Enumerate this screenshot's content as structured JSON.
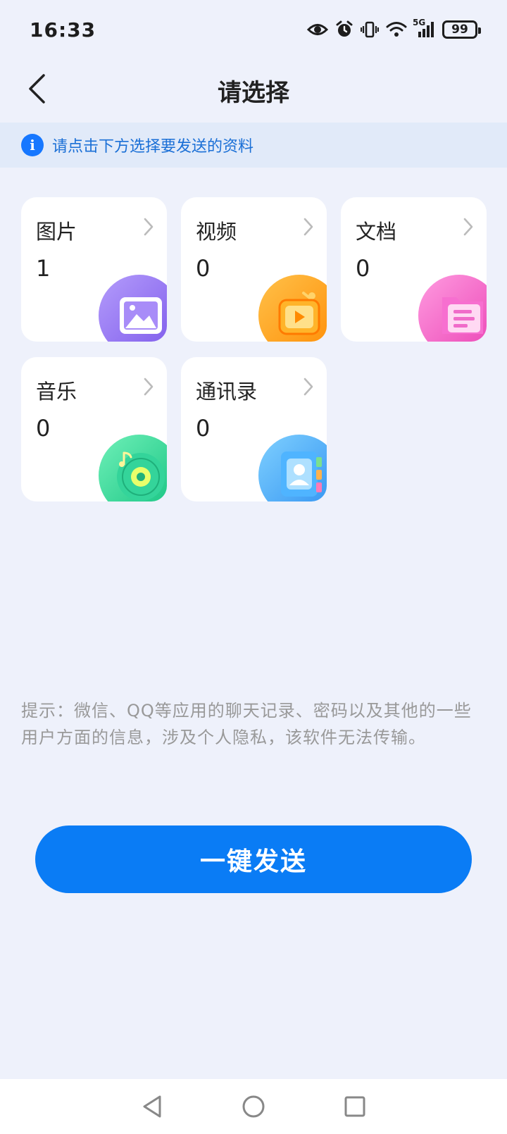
{
  "status_bar": {
    "time": "16:33",
    "network": "5G",
    "battery": "99",
    "icons": [
      "eye-icon",
      "alarm-icon",
      "vibrate-icon",
      "wifi-icon",
      "signal-icon",
      "battery-icon"
    ]
  },
  "header": {
    "title": "请选择",
    "back_icon": "chevron-left-icon"
  },
  "banner": {
    "icon": "info-icon",
    "text": "请点击下方选择要发送的资料"
  },
  "categories": [
    {
      "label": "图片",
      "count": "1",
      "icon": "image-icon",
      "color": "#8b6cf0"
    },
    {
      "label": "视频",
      "count": "0",
      "icon": "video-icon",
      "color": "#ff9d1a"
    },
    {
      "label": "文档",
      "count": "0",
      "icon": "document-icon",
      "color": "#f35cc7"
    },
    {
      "label": "音乐",
      "count": "0",
      "icon": "music-icon",
      "color": "#2fd39a"
    },
    {
      "label": "通讯录",
      "count": "0",
      "icon": "contacts-icon",
      "color": "#2f9cf5"
    }
  ],
  "notice": "提示：微信、QQ等应用的聊天记录、密码以及其他的一些用户方面的信息，涉及个人隐私，该软件无法传输。",
  "send_button": {
    "label": "一键发送",
    "color": "#0a7cf5"
  },
  "nav": {
    "icons": [
      "nav-back-icon",
      "nav-home-icon",
      "nav-recents-icon"
    ]
  }
}
